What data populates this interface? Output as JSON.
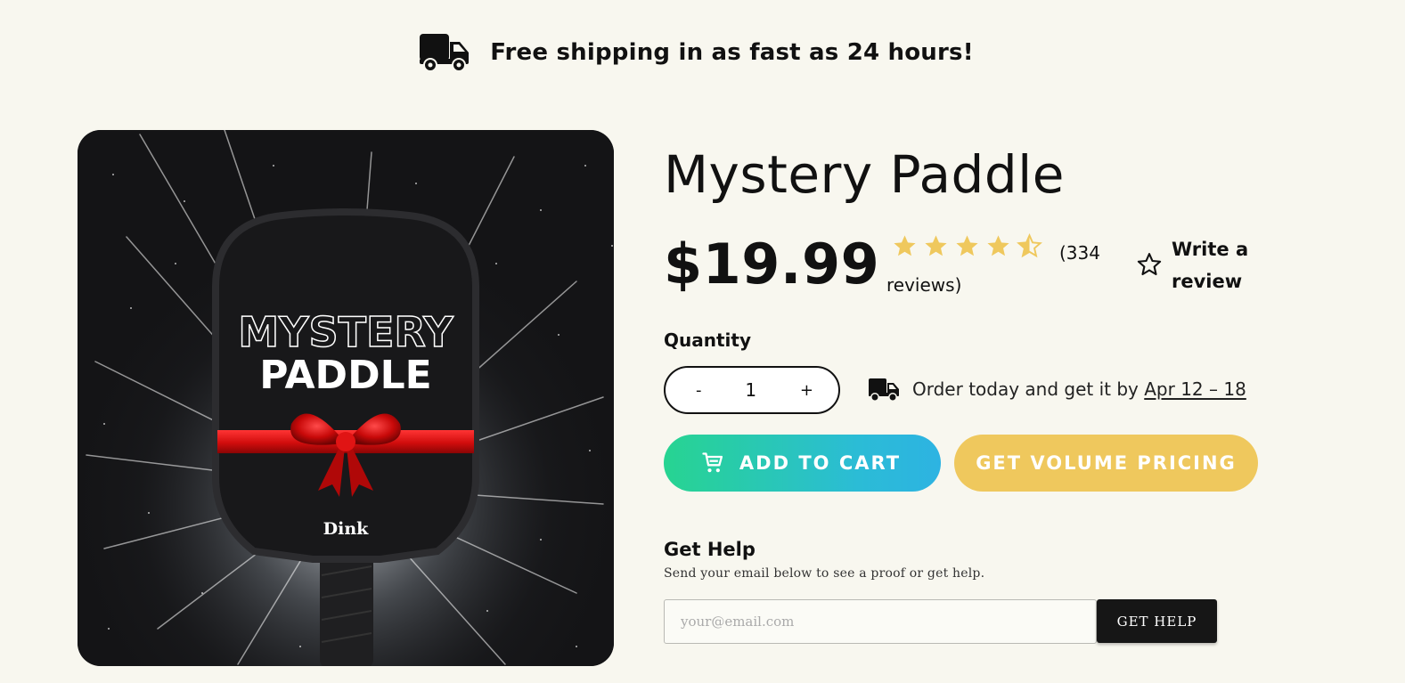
{
  "banner": {
    "icon": "truck-icon",
    "text": "Free shipping in as fast as 24 hours!"
  },
  "product": {
    "title": "Mystery Paddle",
    "price": "$19.99",
    "image": {
      "line1": "MYSTERY",
      "line2": "PADDLE",
      "brand": "Dink",
      "colors": {
        "background": "#141416",
        "paddle": "#18181a",
        "ribbon": "#d11010"
      }
    },
    "rating": {
      "value": 4.5,
      "max": 5,
      "reviews_text": "(334 reviews)",
      "star_color": "#efc85d"
    },
    "write_review": {
      "icon": "star-outline-icon",
      "label": "Write a review"
    }
  },
  "quantity": {
    "label": "Quantity",
    "minus": "-",
    "value": "1",
    "plus": "+"
  },
  "delivery": {
    "icon": "truck-icon",
    "text": "Order today and get it by",
    "date": "Apr 12 – 18"
  },
  "actions": {
    "add_to_cart": {
      "icon": "cart-icon",
      "label": "ADD TO CART",
      "gradient": [
        "#27d491",
        "#2db3e2"
      ]
    },
    "volume_pricing": {
      "label": "GET VOLUME PRICING",
      "color": "#efc85d"
    }
  },
  "help": {
    "title": "Get Help",
    "subtitle": "Send your email below to see a proof or get help.",
    "email_placeholder": "your@email.com",
    "button": "GET HELP"
  },
  "theme": {
    "background": "#f8f7ef",
    "text": "#111111"
  }
}
